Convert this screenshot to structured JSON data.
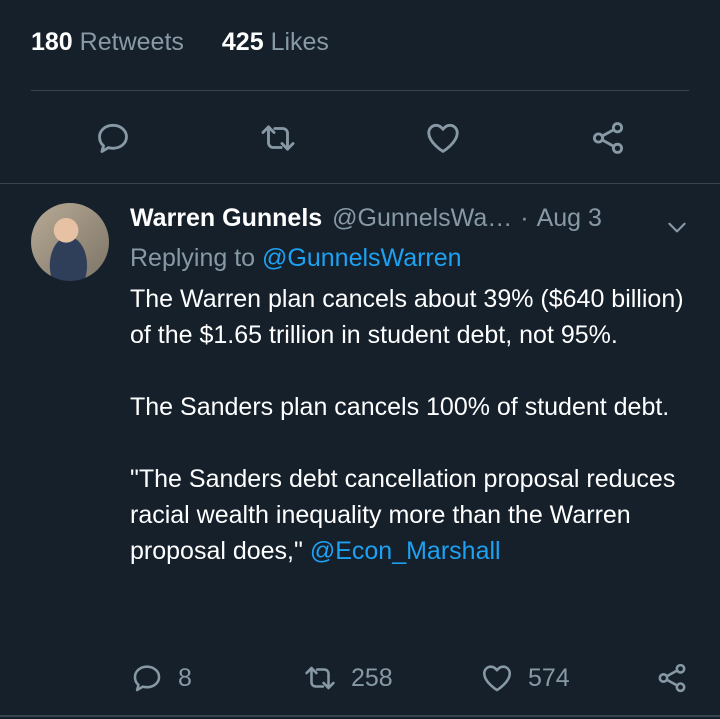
{
  "stats": {
    "retweets_count": "180",
    "retweets_label": "Retweets",
    "likes_count": "425",
    "likes_label": "Likes"
  },
  "top_actions": [
    {
      "icon": "reply-icon"
    },
    {
      "icon": "retweet-icon"
    },
    {
      "icon": "like-icon"
    },
    {
      "icon": "share-icon"
    }
  ],
  "reply": {
    "author_name": "Warren Gunnels",
    "author_handle": "@GunnelsWa…",
    "separator": "·",
    "timestamp": "Aug 3",
    "replying_prefix": "Replying to",
    "replying_to": "@GunnelsWarren",
    "paragraphs": [
      "The Warren plan cancels about 39% ($640 billion) of the $1.65 trillion in student debt, not 95%.",
      "The Sanders plan cancels 100% of student debt."
    ],
    "quote_text": "\"The Sanders debt cancellation proposal reduces racial wealth inequality more than the Warren proposal does,\"",
    "quote_mention": "@Econ_Marshall",
    "actions": {
      "replies": "8",
      "retweets": "258",
      "likes": "574"
    }
  },
  "colors": {
    "background": "#15202b",
    "secondary_text": "#8899a6",
    "link": "#1da1f2",
    "divider": "#38444d"
  }
}
